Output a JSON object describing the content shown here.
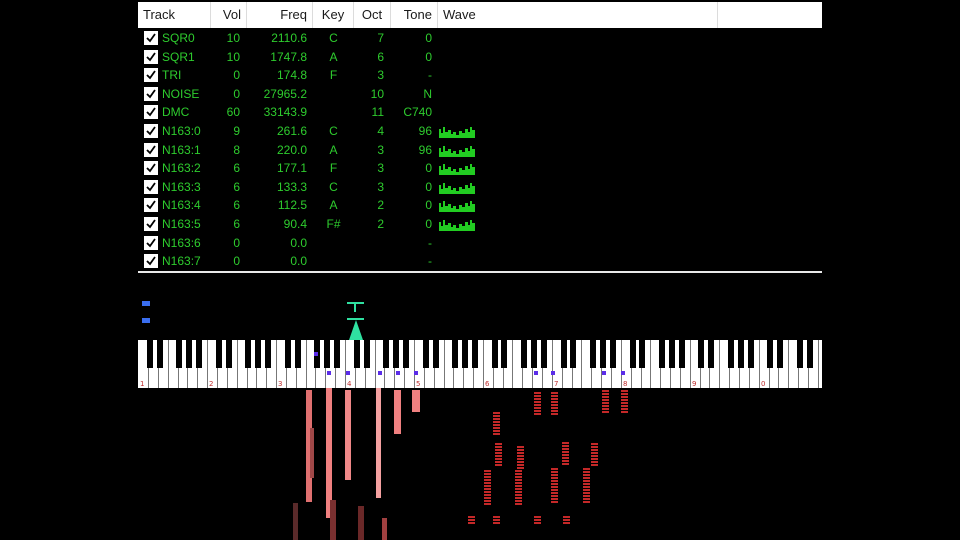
{
  "columns": {
    "track": "Track",
    "vol": "Vol",
    "freq": "Freq",
    "key": "Key",
    "oct": "Oct",
    "tone": "Tone",
    "wave": "Wave"
  },
  "colors": {
    "text_green": "#2ecc2e",
    "wave_green": "#22cc22",
    "marker_blue": "#3a6ef0",
    "note_purple": "#5b2de8",
    "indicator_teal": "#2fe0a0",
    "roll_red": "#c42828",
    "roll_pink": "#f08080"
  },
  "tracks": [
    {
      "name": "SQR0",
      "vol": "10",
      "freq": "2110.6",
      "key": "C",
      "oct": "7",
      "tone": "0",
      "checked": true,
      "wave": false
    },
    {
      "name": "SQR1",
      "vol": "10",
      "freq": "1747.8",
      "key": "A",
      "oct": "6",
      "tone": "0",
      "checked": true,
      "wave": false
    },
    {
      "name": "TRI",
      "vol": "0",
      "freq": "174.8",
      "key": "F",
      "oct": "3",
      "tone": "-",
      "checked": true,
      "wave": false
    },
    {
      "name": "NOISE",
      "vol": "0",
      "freq": "27965.2",
      "key": "",
      "oct": "10",
      "tone": "N",
      "checked": true,
      "wave": false
    },
    {
      "name": "DMC",
      "vol": "60",
      "freq": "33143.9",
      "key": "",
      "oct": "11",
      "tone": "C740",
      "checked": true,
      "wave": false
    },
    {
      "name": "N163:0",
      "vol": "9",
      "freq": "261.6",
      "key": "C",
      "oct": "4",
      "tone": "96",
      "checked": true,
      "wave": true
    },
    {
      "name": "N163:1",
      "vol": "8",
      "freq": "220.0",
      "key": "A",
      "oct": "3",
      "tone": "96",
      "checked": true,
      "wave": true
    },
    {
      "name": "N163:2",
      "vol": "6",
      "freq": "177.1",
      "key": "F",
      "oct": "3",
      "tone": "0",
      "checked": true,
      "wave": true
    },
    {
      "name": "N163:3",
      "vol": "6",
      "freq": "133.3",
      "key": "C",
      "oct": "3",
      "tone": "0",
      "checked": true,
      "wave": true
    },
    {
      "name": "N163:4",
      "vol": "6",
      "freq": "112.5",
      "key": "A",
      "oct": "2",
      "tone": "0",
      "checked": true,
      "wave": true
    },
    {
      "name": "N163:5",
      "vol": "6",
      "freq": "90.4",
      "key": "F#",
      "oct": "2",
      "tone": "0",
      "checked": true,
      "wave": true
    },
    {
      "name": "N163:6",
      "vol": "0",
      "freq": "0.0",
      "key": "",
      "oct": "",
      "tone": "-",
      "checked": true,
      "wave": false
    },
    {
      "name": "N163:7",
      "vol": "0",
      "freq": "0.0",
      "key": "",
      "oct": "",
      "tone": "-",
      "checked": true,
      "wave": false
    }
  ],
  "octave_labels": [
    "1",
    "2",
    "3",
    "4",
    "5",
    "6",
    "7",
    "8",
    "9",
    "0"
  ]
}
